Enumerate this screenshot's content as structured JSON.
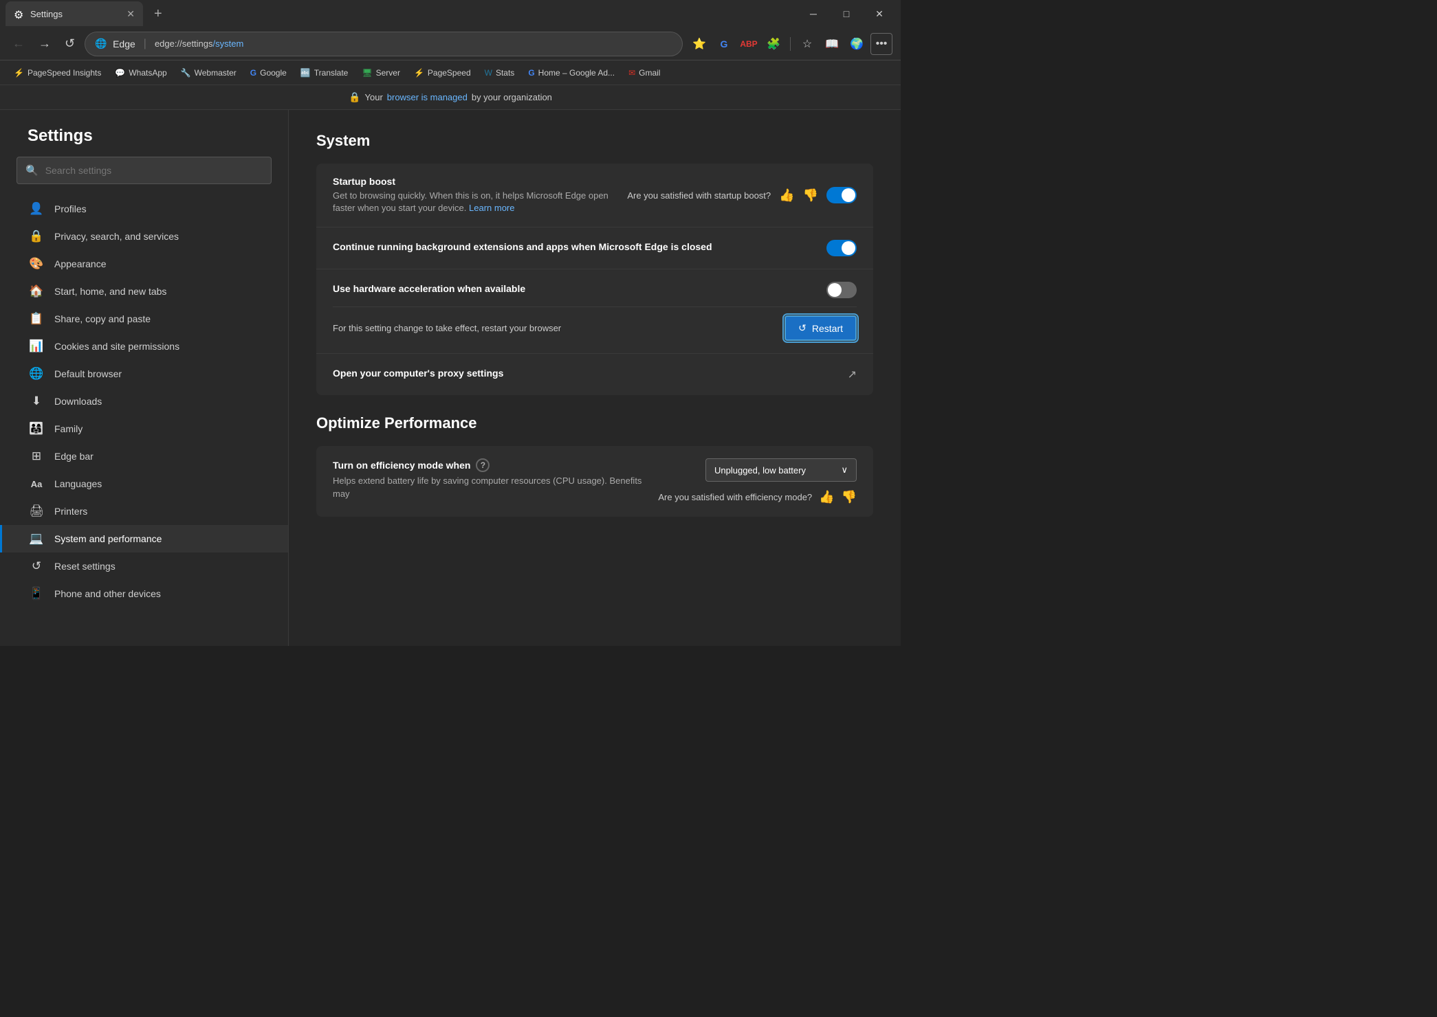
{
  "titlebar": {
    "tab_title": "Settings",
    "tab_close": "✕",
    "new_tab": "+",
    "controls": {
      "minimize": "─",
      "maximize": "□",
      "close": "✕"
    }
  },
  "navbar": {
    "back": "←",
    "forward": "→",
    "refresh": "↺",
    "brand": "Edge",
    "url_settings": "edge://settings",
    "url_path": "/system",
    "separator": "|"
  },
  "bookmarks": [
    {
      "id": "pagespeed-insights",
      "label": "PageSpeed Insights",
      "color": "#4285f4"
    },
    {
      "id": "whatsapp",
      "label": "WhatsApp",
      "color": "#25d366"
    },
    {
      "id": "webmaster",
      "label": "Webmaster",
      "color": "#1a73e8"
    },
    {
      "id": "google",
      "label": "Google",
      "color": "#4285f4"
    },
    {
      "id": "translate",
      "label": "Translate",
      "color": "#4285f4"
    },
    {
      "id": "server",
      "label": "Server",
      "color": "#34a853"
    },
    {
      "id": "pagespeed2",
      "label": "PageSpeed",
      "color": "#4285f4"
    },
    {
      "id": "stats",
      "label": "Stats",
      "color": "#21759b"
    },
    {
      "id": "home-google-ads",
      "label": "Home – Google Ad...",
      "color": "#4285f4"
    },
    {
      "id": "gmail",
      "label": "Gmail",
      "color": "#d93025"
    }
  ],
  "infobar": {
    "icon": "🔒",
    "text_before": "Your",
    "link_text": "browser is managed",
    "text_after": "by your organization"
  },
  "sidebar": {
    "title": "Settings",
    "search_placeholder": "Search settings",
    "nav_items": [
      {
        "id": "profiles",
        "label": "Profiles",
        "icon": "👤"
      },
      {
        "id": "privacy",
        "label": "Privacy, search, and services",
        "icon": "🔒"
      },
      {
        "id": "appearance",
        "label": "Appearance",
        "icon": "🎨"
      },
      {
        "id": "start-home",
        "label": "Start, home, and new tabs",
        "icon": "🏠"
      },
      {
        "id": "share-copy",
        "label": "Share, copy and paste",
        "icon": "📋"
      },
      {
        "id": "cookies",
        "label": "Cookies and site permissions",
        "icon": "📊"
      },
      {
        "id": "default-browser",
        "label": "Default browser",
        "icon": "🌐"
      },
      {
        "id": "downloads",
        "label": "Downloads",
        "icon": "⬇"
      },
      {
        "id": "family",
        "label": "Family",
        "icon": "👨‍👩‍👧"
      },
      {
        "id": "edge-bar",
        "label": "Edge bar",
        "icon": "⊞"
      },
      {
        "id": "languages",
        "label": "Languages",
        "icon": "Aa"
      },
      {
        "id": "printers",
        "label": "Printers",
        "icon": "🖨"
      },
      {
        "id": "system",
        "label": "System and performance",
        "icon": "💻",
        "active": true
      },
      {
        "id": "reset",
        "label": "Reset settings",
        "icon": "↺"
      },
      {
        "id": "phone",
        "label": "Phone and other devices",
        "icon": "📱"
      }
    ]
  },
  "content": {
    "system_title": "System",
    "startup_boost": {
      "title": "Startup boost",
      "description": "Get to browsing quickly. When this is on, it helps Microsoft Edge open faster when you start your device.",
      "learn_more": "Learn more",
      "satisfaction_question": "Are you satisfied with startup boost?",
      "toggle_state": "on"
    },
    "background_extensions": {
      "title": "Continue running background extensions and apps when Microsoft Edge is closed",
      "toggle_state": "on"
    },
    "hardware_acceleration": {
      "title": "Use hardware acceleration when available",
      "toggle_state": "off",
      "restart_note": "For this setting change to take effect, restart your browser",
      "restart_label": "Restart"
    },
    "proxy_settings": {
      "title": "Open your computer's proxy settings"
    },
    "optimize_title": "Optimize Performance",
    "efficiency_mode": {
      "title": "Turn on efficiency mode when",
      "description": "Helps extend battery life by saving computer resources (CPU usage). Benefits may",
      "dropdown_label": "Unplugged, low battery",
      "satisfaction_question": "Are you satisfied with efficiency mode?"
    }
  }
}
